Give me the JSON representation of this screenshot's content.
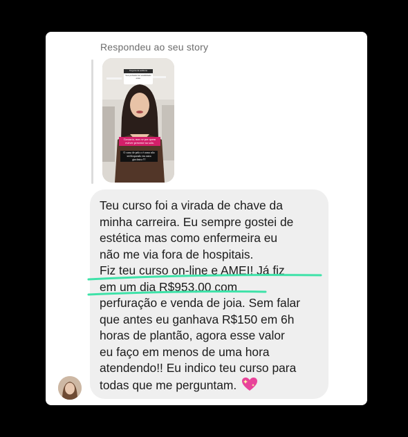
{
  "dm": {
    "reply_label": "Respondeu ao seu story",
    "message_lines": [
      "Teu curso foi a virada de chave da",
      "minha carreira. Eu sempre gostei de",
      "estética mas como enfermeira eu",
      "não me via fora de hospitais.",
      "Fiz teu curso on-line e AMEI! Já fiz",
      "em um dia R$953,00 com",
      "perfuração e venda de joia. Sem falar",
      "que antes eu ganhava R$150 em 6h",
      "horas de plantão, agora esse valor",
      "eu faço em menos de uma hora",
      "atendendo!! Eu indico teu curso para",
      "todas que me perguntam."
    ],
    "emoji_icon": "sparkling-heart-icon",
    "highlight_color": "#3ee2a8"
  },
  "story": {
    "top_card_title": "Pergunta da audiência",
    "top_card_text": "Sua profissão faz estabilidade essa.",
    "pink_sticker_text": "Gostaria, mas se pra quem estiver presente na sala.",
    "black_sticker_text": "O curso de pelo o é como não irá bloqueado em outra gincânica !!!"
  }
}
